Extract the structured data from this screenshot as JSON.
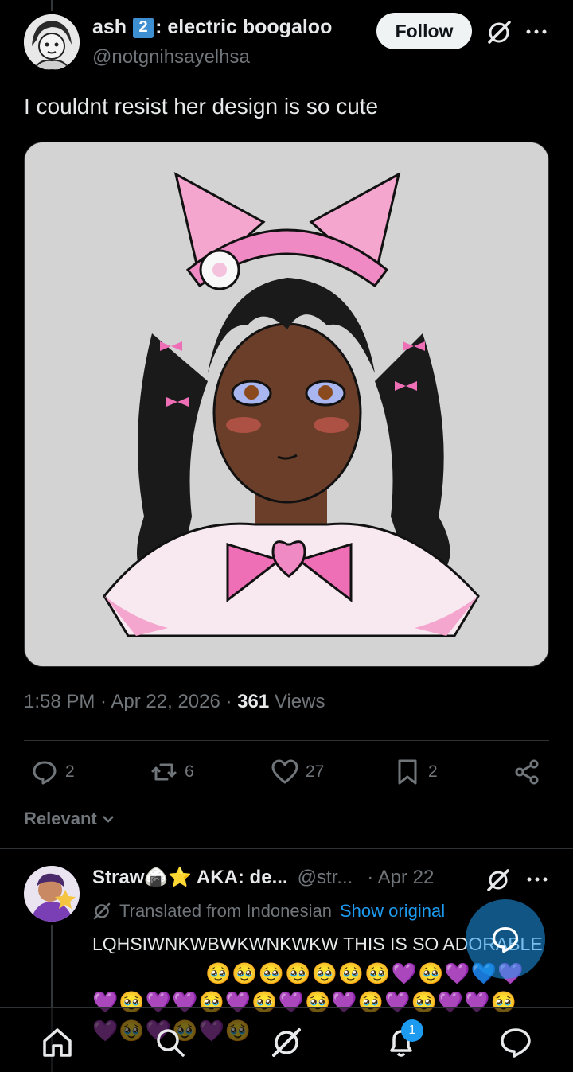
{
  "post": {
    "display_name_prefix": "ash",
    "display_name_badge": "2",
    "display_name_suffix": ": electric boogaloo",
    "handle": "@notgnihsayelhsa",
    "follow_label": "Follow",
    "text": "I couldnt resist her design is so cute",
    "time": "1:58 PM",
    "date": "Apr 22, 2026",
    "views_count": "361",
    "views_label": "Views",
    "replies": "2",
    "reposts": "6",
    "likes": "27",
    "bookmarks": "2"
  },
  "sort": {
    "label": "Relevant"
  },
  "reply": {
    "name": "Straw🍙⭐ AKA: de...",
    "handle": "@str...",
    "date": "· Apr 22",
    "translated_label": "Translated from Indonesian",
    "show_original": "Show original",
    "text": "LQHSIWNKWBWKWNKWKW THIS IS SO ADORABLE",
    "emojis_line1": "🥹🥹🥹🥹🥹🥹🥹💜🥹💜💙💜",
    "emojis_line2": "💜🥹💜💜🥹💜🥹💜🥹💜🥹💜🥹💜💜🥹",
    "emojis_line3": "💜🥹💜🥹💜🥹"
  },
  "nav": {
    "notification_count": "1"
  },
  "icons": [
    "grok-icon",
    "more-icon",
    "reply-icon",
    "repost-icon",
    "like-icon",
    "bookmark-icon",
    "share-icon",
    "home-icon",
    "search-icon",
    "notifications-icon",
    "messages-icon",
    "chevron-down-icon",
    "compose-icon"
  ],
  "colors": {
    "accent": "#1d9bf0",
    "muted": "#71767b",
    "text": "#e7e9ea",
    "background": "#000000"
  }
}
